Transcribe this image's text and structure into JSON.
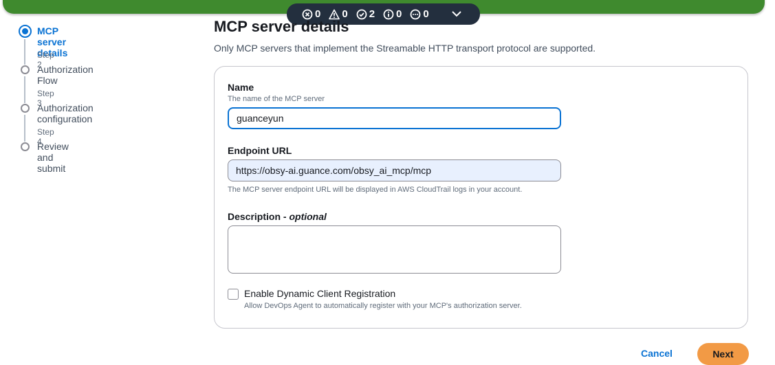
{
  "status_bar": {
    "errors": "0",
    "warnings": "0",
    "success": "2",
    "info": "0",
    "pending": "0"
  },
  "steps": [
    {
      "label": "MCP server details",
      "active": true
    },
    {
      "step_label": "Step 2",
      "label": "Authorization Flow"
    },
    {
      "step_label": "Step 3",
      "label": "Authorization configuration"
    },
    {
      "step_label": "Step 4",
      "label": "Review and submit"
    }
  ],
  "main": {
    "title": "MCP server details",
    "description": "Only MCP servers that implement the Streamable HTTP transport protocol are supported."
  },
  "form": {
    "name_label": "Name",
    "name_hint": "The name of the MCP server",
    "name_value": "guanceyun",
    "endpoint_label": "Endpoint URL",
    "endpoint_value": "https://obsy-ai.guance.com/obsy_ai_mcp/mcp",
    "endpoint_hint": "The MCP server endpoint URL will be displayed in AWS CloudTrail logs in your account.",
    "description_label": "Description",
    "description_optional": "optional",
    "description_value": "",
    "dcr_label": "Enable Dynamic Client Registration",
    "dcr_desc": "Allow DevOps Agent to automatically register with your MCP's authorization server.",
    "dcr_checked": false
  },
  "footer": {
    "cancel_label": "Cancel",
    "next_label": "Next"
  },
  "colors": {
    "accent": "#0972d3",
    "top_bar": "#3f8a2e",
    "primary_button": "#f29a45"
  }
}
